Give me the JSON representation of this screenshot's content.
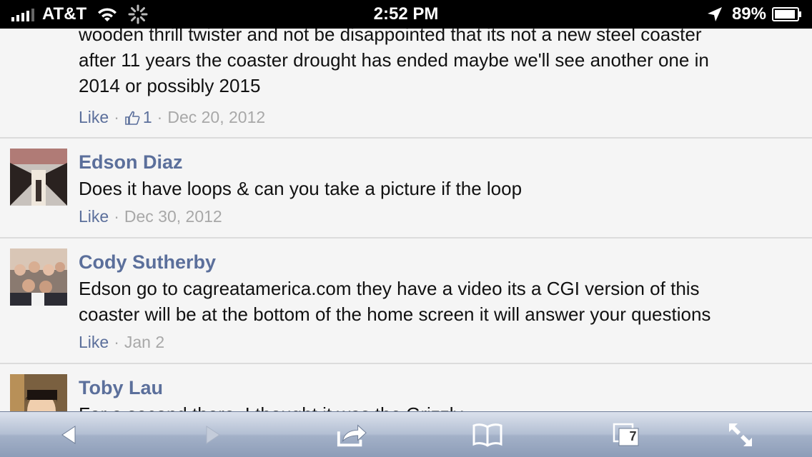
{
  "status_bar": {
    "carrier": "AT&T",
    "time": "2:52 PM",
    "battery": "89%"
  },
  "comments": [
    {
      "text_lines": [
        "wooden thrill twister and not be disappointed that its not a new steel coaster",
        "after 11 years the coaster drought has ended maybe we'll see another one in",
        "2014 or possibly 2015"
      ],
      "like_label": "Like",
      "like_count": "1",
      "date": "Dec 20, 2012"
    },
    {
      "author": "Edson Diaz",
      "text_lines": [
        "Does it have loops & can you take a picture if the loop"
      ],
      "like_label": "Like",
      "date": "Dec 30, 2012"
    },
    {
      "author": "Cody Sutherby",
      "text_lines": [
        "Edson go to cagreatamerica.com they have a video its a CGI version of this",
        "coaster will be at the bottom of the home screen it will answer your questions"
      ],
      "like_label": "Like",
      "date": "Jan 2"
    },
    {
      "author": "Toby Lau",
      "text_lines": [
        "For a second there, I thought it was the Grizzly"
      ]
    }
  ],
  "toolbar": {
    "tabs_count": "7",
    "icons": [
      "back-icon",
      "forward-icon",
      "share-icon",
      "bookmarks-icon",
      "tabs-icon",
      "fullscreen-icon"
    ]
  },
  "colors": {
    "author": "#5b6f9b",
    "meta": "#a8a8a8",
    "background": "#f5f5f5"
  }
}
